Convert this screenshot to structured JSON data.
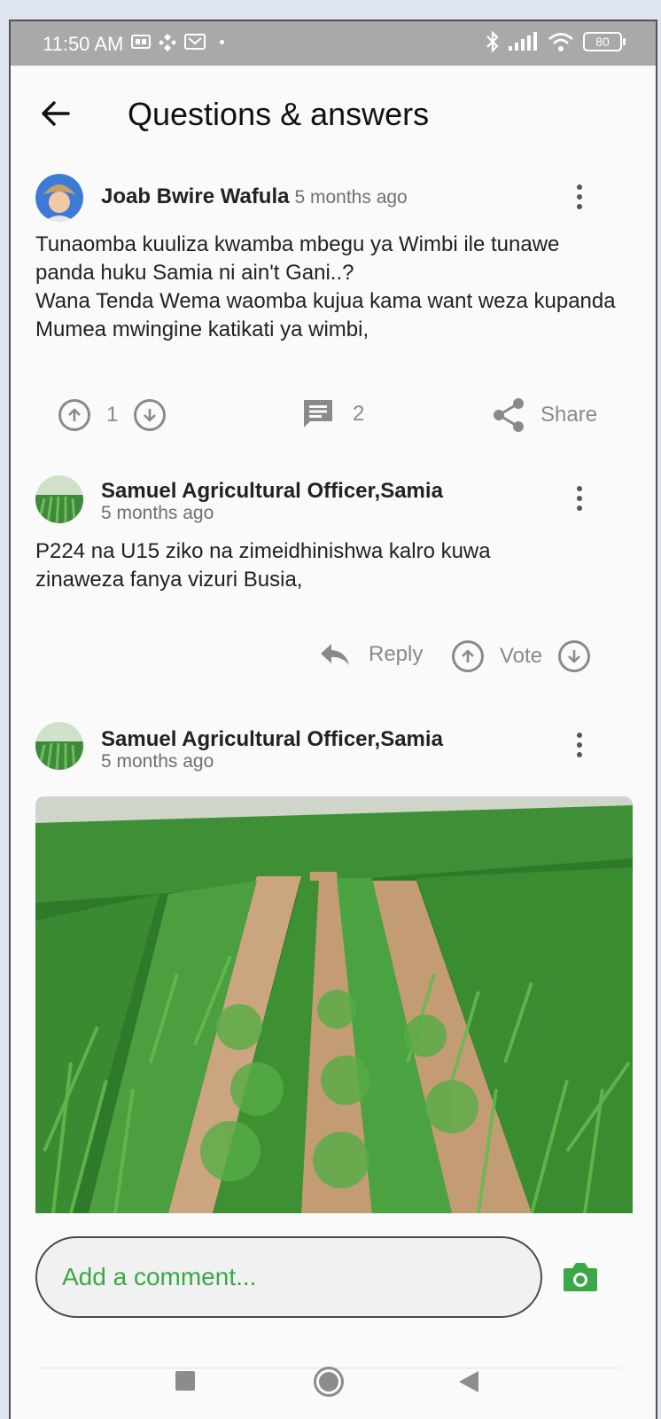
{
  "status_bar": {
    "time": "11:50 AM",
    "battery": "80",
    "notification_icons": [
      "sim-icon",
      "binance-icon",
      "sim-card-icon"
    ],
    "status_icons": [
      "bluetooth-icon",
      "signal-icon",
      "wifi-icon",
      "battery-icon"
    ]
  },
  "header": {
    "title": "Questions & answers"
  },
  "question": {
    "author": "Joab Bwire Wafula",
    "time": "5 months ago",
    "text": "Tunaomba kuuliza kwamba mbegu ya Wimbi ile tunawe panda huku Samia ni ain't Gani..?\nWana Tenda  Wema  waomba kujua kama want weza kupanda Mumea mwingine katikati ya wimbi,",
    "votes": "1",
    "comments": "2",
    "share_label": "Share"
  },
  "answers": [
    {
      "author": "Samuel Agricultural Officer,Samia",
      "time": "5 months ago",
      "text": "P224 na U15 ziko na zimeidhinishwa kalro kuwa zinaweza fanya vizuri Busia,",
      "reply_label": "Reply",
      "vote_label": "Vote"
    },
    {
      "author": "Samuel Agricultural Officer,Samia",
      "time": "5 months ago"
    }
  ],
  "composer": {
    "placeholder": "Add a comment..."
  },
  "colors": {
    "accent": "#3aa845",
    "icon_gray": "#8a8a8a",
    "status_bar": "#a9a9a9"
  }
}
